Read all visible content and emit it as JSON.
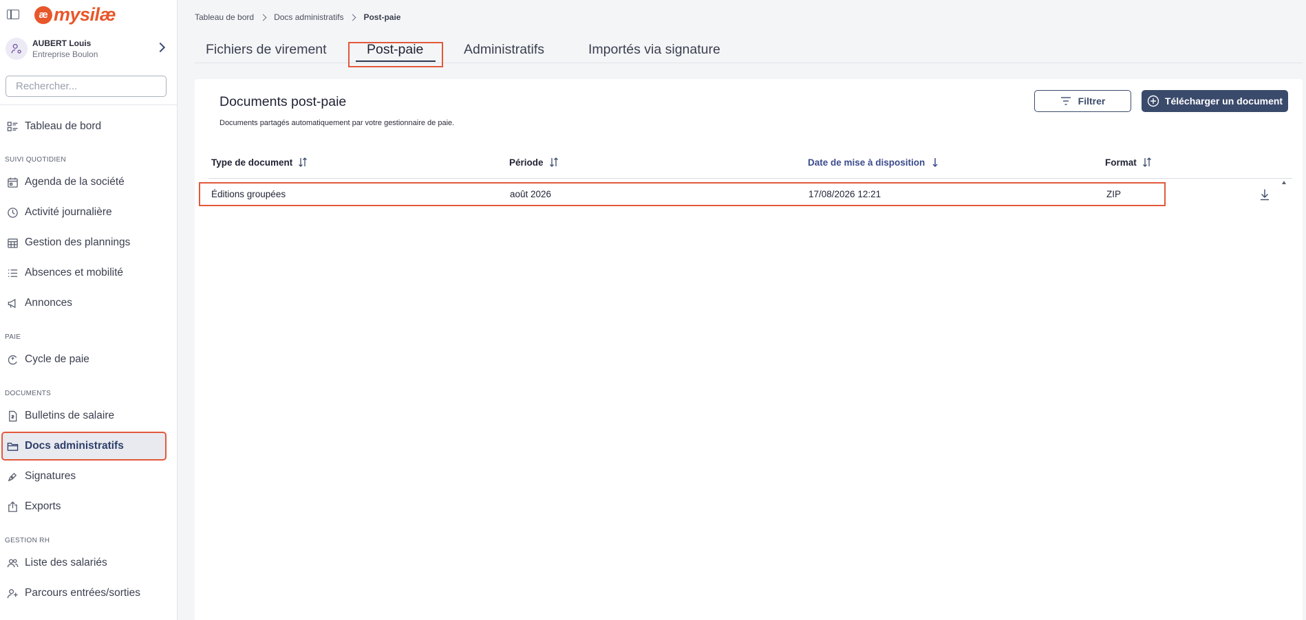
{
  "app": {
    "logo_badge": "æ",
    "logo_text": "mysilæ",
    "brand_color": "#e8572a",
    "accent_color": "#3a4a6b",
    "highlight_color": "#e2583a"
  },
  "user": {
    "name": "AUBERT Louis",
    "company": "Entreprise Boulon"
  },
  "search": {
    "placeholder": "Rechercher..."
  },
  "sidebar": {
    "dashboard": {
      "label": "Tableau de bord",
      "icon": "dashboard-icon"
    },
    "sections": {
      "daily": "SUIVI QUOTIDIEN",
      "payroll": "PAIE",
      "documents": "DOCUMENTS",
      "hr": "GESTION RH"
    },
    "items": {
      "agenda": {
        "label": "Agenda de la société",
        "icon": "calendar-icon"
      },
      "activity": {
        "label": "Activité journalière",
        "icon": "clock-icon"
      },
      "plannings": {
        "label": "Gestion des plannings",
        "icon": "grid-calendar-icon"
      },
      "absences": {
        "label": "Absences et mobilité",
        "icon": "list-icon"
      },
      "announcements": {
        "label": "Annonces",
        "icon": "megaphone-icon"
      },
      "paycycle": {
        "label": "Cycle de paie",
        "icon": "cycle-icon"
      },
      "payslips": {
        "label": "Bulletins de salaire",
        "icon": "payslip-icon"
      },
      "admin_docs": {
        "label": "Docs administratifs",
        "icon": "folder-icon",
        "active": true
      },
      "signatures": {
        "label": "Signatures",
        "icon": "pen-icon"
      },
      "exports": {
        "label": "Exports",
        "icon": "export-icon"
      },
      "employees": {
        "label": "Liste des salariés",
        "icon": "users-icon"
      },
      "onboarding": {
        "label": "Parcours entrées/sorties",
        "icon": "user-plus-icon"
      }
    }
  },
  "breadcrumb": {
    "items": [
      "Tableau de bord",
      "Docs administratifs"
    ],
    "current": "Post-paie"
  },
  "tabs": [
    "Fichiers de virement",
    "Post-paie",
    "Administratifs",
    "Importés via signature"
  ],
  "active_tab": "Post-paie",
  "card": {
    "title": "Documents post-paie",
    "subtitle": "Documents partagés automatiquement par votre gestionnaire de paie.",
    "filter_label": "Filtrer",
    "upload_label": "Télécharger un document"
  },
  "table": {
    "columns": [
      "Type de document",
      "Période",
      "Date de mise à disposition",
      "Format"
    ],
    "sorted_column": "Date de mise à disposition",
    "rows": [
      {
        "type": "Éditions groupées",
        "period": "août 2026",
        "date": "17/08/2026 12:21",
        "format": "ZIP"
      }
    ]
  }
}
